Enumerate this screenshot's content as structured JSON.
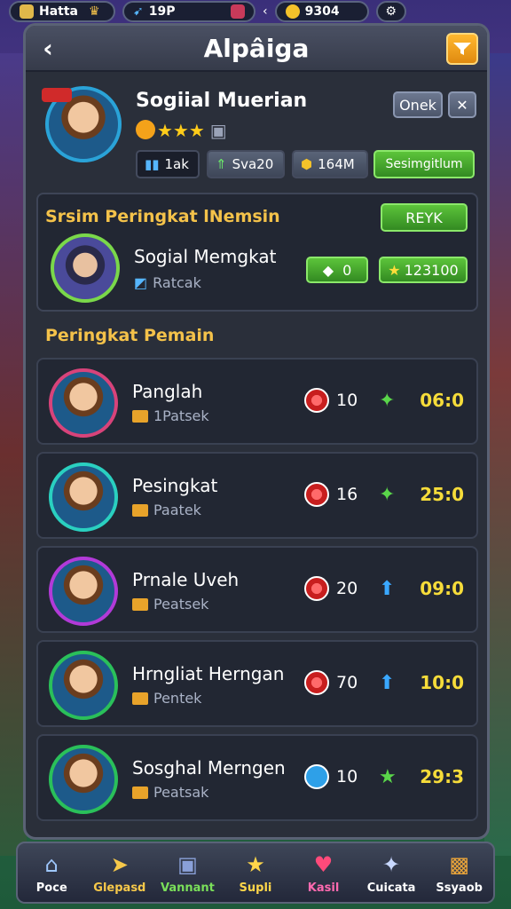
{
  "topbar": {
    "left_label": "Hatta",
    "mid_value": "19P",
    "coins": "9304"
  },
  "header": {
    "title": "Alpâiga"
  },
  "profile": {
    "name": "Sogiial Muerian",
    "stars": "★★★",
    "onek_button": "Onek",
    "close_button": "✕",
    "stat_1": "1ak",
    "stat_2": "Sva20",
    "stat_3": "164M",
    "action_button": "Sesimgitlum"
  },
  "rank_system": {
    "title": "Srsim Peringkat lNemsin",
    "button": "REYK",
    "name": "Sogial Memgkat",
    "sub": "Ratcak",
    "value_1": "0",
    "value_2": "123100"
  },
  "ranking": {
    "title": "Peringkat Pemain",
    "players": [
      {
        "name": "Panglah",
        "sub": "1Patsek",
        "level": "10",
        "score": "06:0",
        "badge": "red",
        "arrow": "green"
      },
      {
        "name": "Pesingkat",
        "sub": "Paatek",
        "level": "16",
        "score": "25:0",
        "badge": "red",
        "arrow": "green"
      },
      {
        "name": "Prnale Uveh",
        "sub": "Peatsek",
        "level": "20",
        "score": "09:0",
        "badge": "red",
        "arrow": "blue"
      },
      {
        "name": "Hrngliat Herngan",
        "sub": "Pentek",
        "level": "70",
        "score": "10:0",
        "badge": "red",
        "arrow": "blue"
      },
      {
        "name": "Sosghal Merngen",
        "sub": "Peatsak",
        "level": "10",
        "score": "29:3",
        "badge": "blue",
        "arrow": "star"
      }
    ]
  },
  "navbar": {
    "items": [
      {
        "label": "Poce",
        "color": "#ffffff"
      },
      {
        "label": "Glepasd",
        "color": "#f6c84a"
      },
      {
        "label": "Vannant",
        "color": "#7adf5a"
      },
      {
        "label": "Supli",
        "color": "#ffd64a"
      },
      {
        "label": "Kasil",
        "color": "#ff6ab0"
      },
      {
        "label": "Cuicata",
        "color": "#ffffff"
      },
      {
        "label": "Ssyaob",
        "color": "#ffffff"
      }
    ]
  },
  "colors": {
    "accent_gold": "#f4c24a",
    "score_yellow": "#f6dc3a",
    "button_green": "#4caf2f"
  }
}
